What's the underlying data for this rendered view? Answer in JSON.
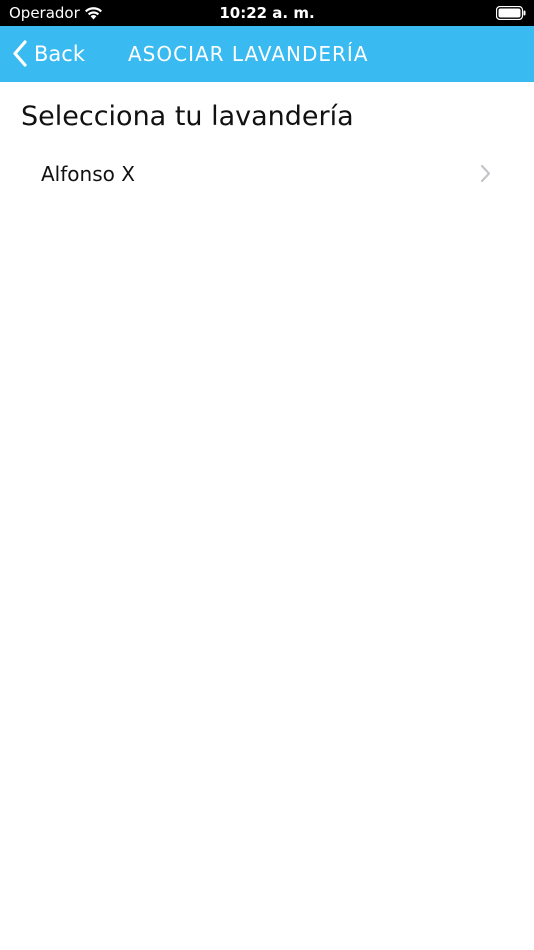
{
  "status_bar": {
    "carrier": "Operador",
    "time": "10:22 a. m.",
    "wifi_icon": "wifi-icon",
    "battery_icon": "battery-icon"
  },
  "nav_bar": {
    "back_label": "Back",
    "back_icon": "chevron-left-icon",
    "title": "ASOCIAR LAVANDERÍA",
    "color": "#39baf1"
  },
  "main": {
    "section_title": "Selecciona tu lavandería",
    "items": [
      {
        "label": "Alfonso X",
        "icon": "chevron-right-icon"
      }
    ]
  }
}
